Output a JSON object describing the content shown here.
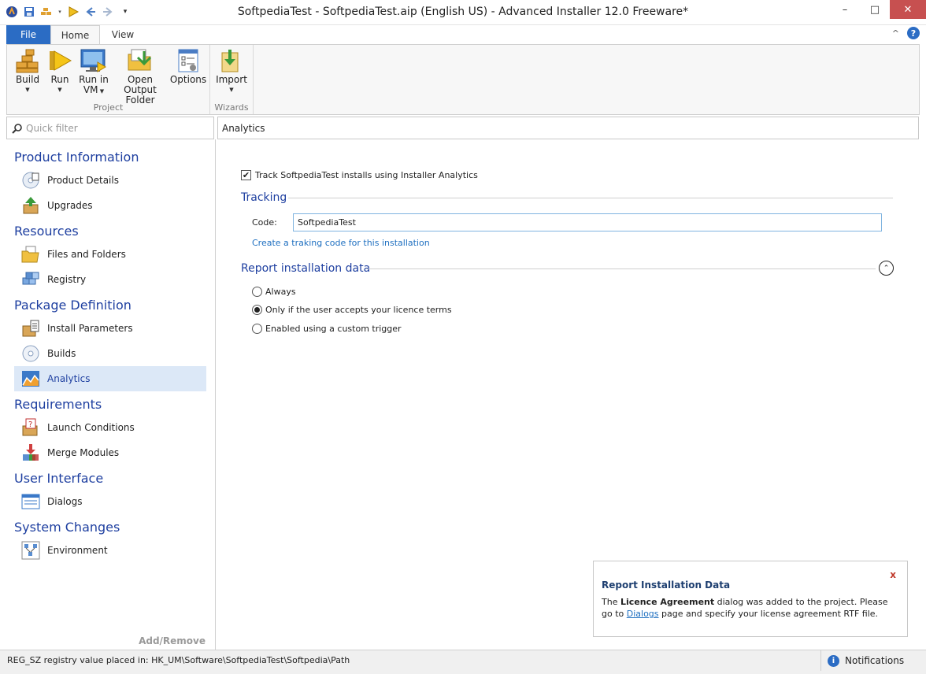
{
  "window": {
    "title": "SoftpediaTest - SoftpediaTest.aip (English US) - Advanced Installer 12.0 Freeware*",
    "minimize": "–",
    "maximize": "□",
    "close": "✕"
  },
  "ribbon_tabs": {
    "file": "File",
    "home": "Home",
    "view": "View",
    "collapse": "^",
    "help": "?"
  },
  "ribbon": {
    "build": "Build",
    "run": "Run",
    "run_in_vm_1": "Run in",
    "run_in_vm_2": "VM",
    "open_output_1": "Open Output",
    "open_output_2": "Folder",
    "options": "Options",
    "import": "Import",
    "group_project": "Project",
    "group_wizards": "Wizards"
  },
  "filter": {
    "placeholder": "Quick filter"
  },
  "sidebar": {
    "cat_product_info": "Product Information",
    "product_details": "Product Details",
    "upgrades": "Upgrades",
    "cat_resources": "Resources",
    "files_folders": "Files and Folders",
    "registry": "Registry",
    "cat_package_def": "Package Definition",
    "install_params": "Install Parameters",
    "builds": "Builds",
    "analytics": "Analytics",
    "cat_requirements": "Requirements",
    "launch_conditions": "Launch Conditions",
    "merge_modules": "Merge Modules",
    "cat_user_interface": "User Interface",
    "dialogs": "Dialogs",
    "cat_system_changes": "System Changes",
    "environment": "Environment",
    "add_remove": "Add/Remove"
  },
  "content": {
    "header": "Analytics",
    "track_label": "Track SoftpediaTest installs using Installer Analytics",
    "track_checked": "✔",
    "tracking_section": "Tracking",
    "code_label": "Code:",
    "code_value": "SoftpediaTest",
    "create_link": "Create a traking code for this installation",
    "report_section": "Report installation data",
    "collapse_symbol": "⌃",
    "radio_always": "Always",
    "radio_only_if": "Only if the user accepts your licence terms",
    "radio_custom": "Enabled using a custom trigger"
  },
  "notification": {
    "close": "x",
    "title": "Report Installation Data",
    "body_pre": "The ",
    "body_bold": "Licence Agreement",
    "body_mid": " dialog was added to the project. Please go to ",
    "body_link": "Dialogs",
    "body_post": " page and specify your license agreement RTF file."
  },
  "statusbar": {
    "text": "REG_SZ registry value placed in: HK_UM\\Software\\SoftpediaTest\\Softpedia\\Path",
    "notifications": "Notifications",
    "info_symbol": "i"
  },
  "colors": {
    "accent": "#2b6cc4",
    "category_text": "#1e3fa0",
    "link": "#1e6fc0",
    "selection": "#dce8f7",
    "close_red": "#c75050"
  }
}
